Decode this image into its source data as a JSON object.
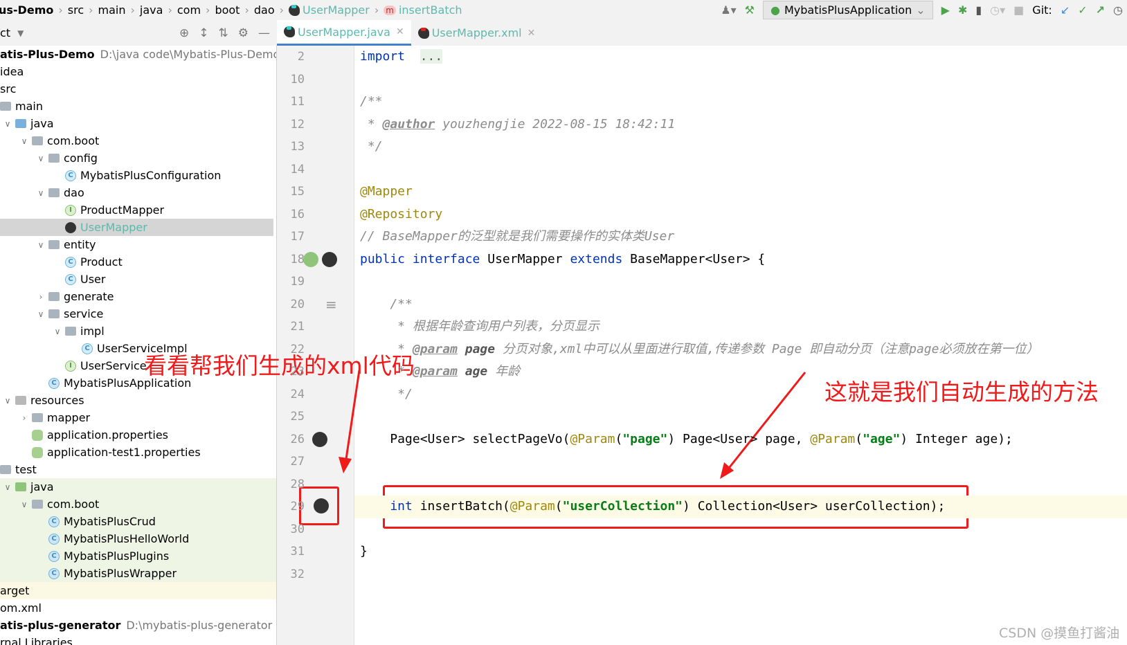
{
  "breadcrumb": [
    "us-Demo",
    "src",
    "main",
    "java",
    "com",
    "boot",
    "dao",
    "UserMapper",
    "insertBatch"
  ],
  "toolbar": {
    "run_config": "MybatisPlusApplication",
    "git_label": "Git:"
  },
  "project_panel": {
    "title": "ct"
  },
  "tabs": [
    {
      "label": "UserMapper.java",
      "active": true
    },
    {
      "label": "UserMapper.xml",
      "active": false
    }
  ],
  "tree": [
    {
      "label": "atis-Plus-Demo",
      "path": "D:\\java code\\Mybatis-Plus-Demo",
      "bold": true,
      "depth": 0,
      "icon": "none"
    },
    {
      "label": "idea",
      "depth": 0,
      "icon": "none"
    },
    {
      "label": "src",
      "depth": 0,
      "icon": "none"
    },
    {
      "label": "main",
      "depth": 0,
      "icon": "folder",
      "noChev": true
    },
    {
      "label": "java",
      "depth": 1,
      "icon": "folder-blue",
      "chev": "open"
    },
    {
      "label": "com.boot",
      "depth": 2,
      "icon": "folder",
      "chev": "open"
    },
    {
      "label": "config",
      "depth": 3,
      "icon": "folder",
      "chev": "open"
    },
    {
      "label": "MybatisPlusConfiguration",
      "depth": 4,
      "icon": "class"
    },
    {
      "label": "dao",
      "depth": 3,
      "icon": "folder",
      "chev": "open"
    },
    {
      "label": "ProductMapper",
      "depth": 4,
      "icon": "interface"
    },
    {
      "label": "UserMapper",
      "depth": 4,
      "icon": "mybatis",
      "selected": true
    },
    {
      "label": "entity",
      "depth": 3,
      "icon": "folder",
      "chev": "open"
    },
    {
      "label": "Product",
      "depth": 4,
      "icon": "class"
    },
    {
      "label": "User",
      "depth": 4,
      "icon": "class"
    },
    {
      "label": "generate",
      "depth": 3,
      "icon": "folder",
      "chev": "closed"
    },
    {
      "label": "service",
      "depth": 3,
      "icon": "folder",
      "chev": "open"
    },
    {
      "label": "impl",
      "depth": 4,
      "icon": "folder",
      "chev": "open"
    },
    {
      "label": "UserServiceImpl",
      "depth": 5,
      "icon": "class"
    },
    {
      "label": "UserService",
      "depth": 4,
      "icon": "interface"
    },
    {
      "label": "MybatisPlusApplication",
      "depth": 3,
      "icon": "spring"
    },
    {
      "label": "resources",
      "depth": 1,
      "icon": "folder-res",
      "chev": "open"
    },
    {
      "label": "mapper",
      "depth": 2,
      "icon": "folder",
      "chev": "closed"
    },
    {
      "label": "application.properties",
      "depth": 2,
      "icon": "properties"
    },
    {
      "label": "application-test1.properties",
      "depth": 2,
      "icon": "properties"
    },
    {
      "label": "test",
      "depth": 0,
      "icon": "folder",
      "noChev": true
    },
    {
      "label": "java",
      "depth": 1,
      "icon": "folder-green",
      "chev": "open",
      "test": true
    },
    {
      "label": "com.boot",
      "depth": 2,
      "icon": "folder",
      "chev": "open",
      "test": true
    },
    {
      "label": "MybatisPlusCrud",
      "depth": 3,
      "icon": "spring",
      "test": true
    },
    {
      "label": "MybatisPlusHelloWorld",
      "depth": 3,
      "icon": "spring",
      "test": true
    },
    {
      "label": "MybatisPlusPlugins",
      "depth": 3,
      "icon": "spring",
      "test": true
    },
    {
      "label": "MybatisPlusWrapper",
      "depth": 3,
      "icon": "spring",
      "test": true
    },
    {
      "label": "arget",
      "depth": 0,
      "icon": "none",
      "target": true
    },
    {
      "label": "om.xml",
      "depth": 0,
      "icon": "none"
    },
    {
      "label": "atis-plus-generator",
      "path": "D:\\mybatis-plus-generator",
      "bold": true,
      "depth": 0,
      "icon": "none"
    },
    {
      "label": "rnal Libraries",
      "depth": 0,
      "icon": "none"
    }
  ],
  "code": [
    {
      "n": "2",
      "t": [
        [
          "kw",
          "import"
        ],
        [
          "",
          "  "
        ],
        [
          "fold",
          "..."
        ]
      ]
    },
    {
      "n": "10",
      "t": []
    },
    {
      "n": "11",
      "t": [
        [
          "cm",
          "/**"
        ]
      ]
    },
    {
      "n": "12",
      "t": [
        [
          "cm",
          " * "
        ],
        [
          "tg",
          "@author"
        ],
        [
          "cm",
          " youzhengjie 2022-08-15 18:42:11"
        ]
      ]
    },
    {
      "n": "13",
      "t": [
        [
          "cm",
          " */"
        ]
      ]
    },
    {
      "n": "14",
      "t": []
    },
    {
      "n": "15",
      "t": [
        [
          "an",
          "@Mapper"
        ]
      ]
    },
    {
      "n": "16",
      "t": [
        [
          "an",
          "@Repository"
        ]
      ]
    },
    {
      "n": "17",
      "t": [
        [
          "cm",
          "// BaseMapper的泛型就是我们需要操作的实体类User"
        ]
      ]
    },
    {
      "n": "18",
      "t": [
        [
          "kw",
          "public interface "
        ],
        [
          "",
          "UserMapper "
        ],
        [
          "kw",
          "extends "
        ],
        [
          "",
          "BaseMapper<User> {"
        ]
      ]
    },
    {
      "n": "19",
      "t": []
    },
    {
      "n": "20",
      "t": [
        [
          "cm",
          "    /**"
        ]
      ]
    },
    {
      "n": "21",
      "t": [
        [
          "cm",
          "     * 根据年龄查询用户列表，分页显示"
        ]
      ]
    },
    {
      "n": "22",
      "t": [
        [
          "cm",
          "     * "
        ],
        [
          "tg",
          "@param"
        ],
        [
          "pn",
          " page"
        ],
        [
          "cm",
          " 分页对象,xml中可以从里面进行取值,传递参数 Page 即自动分页（注意page必须放在第一位）"
        ]
      ]
    },
    {
      "n": "23",
      "t": [
        [
          "cm",
          "     * "
        ],
        [
          "tg",
          "@param"
        ],
        [
          "pn",
          " age"
        ],
        [
          "cm",
          " 年龄"
        ]
      ]
    },
    {
      "n": "24",
      "t": [
        [
          "cm",
          "     */"
        ]
      ]
    },
    {
      "n": "25",
      "t": []
    },
    {
      "n": "26",
      "t": [
        [
          "",
          "    Page<User> selectPageVo("
        ],
        [
          "an",
          "@Param"
        ],
        [
          "",
          "("
        ],
        [
          "st",
          "\"page\""
        ],
        [
          "",
          ") Page<User> page, "
        ],
        [
          "an",
          "@Param"
        ],
        [
          "",
          "("
        ],
        [
          "st",
          "\"age\""
        ],
        [
          "",
          ") Integer age);"
        ]
      ]
    },
    {
      "n": "27",
      "t": []
    },
    {
      "n": "28",
      "t": []
    },
    {
      "n": "29",
      "t": [
        [
          "kw",
          "    int "
        ],
        [
          "",
          "insertBatch("
        ],
        [
          "an",
          "@Param"
        ],
        [
          "",
          "("
        ],
        [
          "st",
          "\"userCollection\""
        ],
        [
          "",
          ") Collection<User> userCollection);"
        ]
      ],
      "current": true
    },
    {
      "n": "30",
      "t": []
    },
    {
      "n": "31",
      "t": [
        [
          "",
          "}"
        ]
      ]
    },
    {
      "n": "32",
      "t": []
    }
  ],
  "annotations": {
    "left": "看看帮我们生成的xml代码",
    "right": "这就是我们自动生成的方法",
    "color": "#f01a1a"
  },
  "watermark": "CSDN @摸鱼打酱油"
}
